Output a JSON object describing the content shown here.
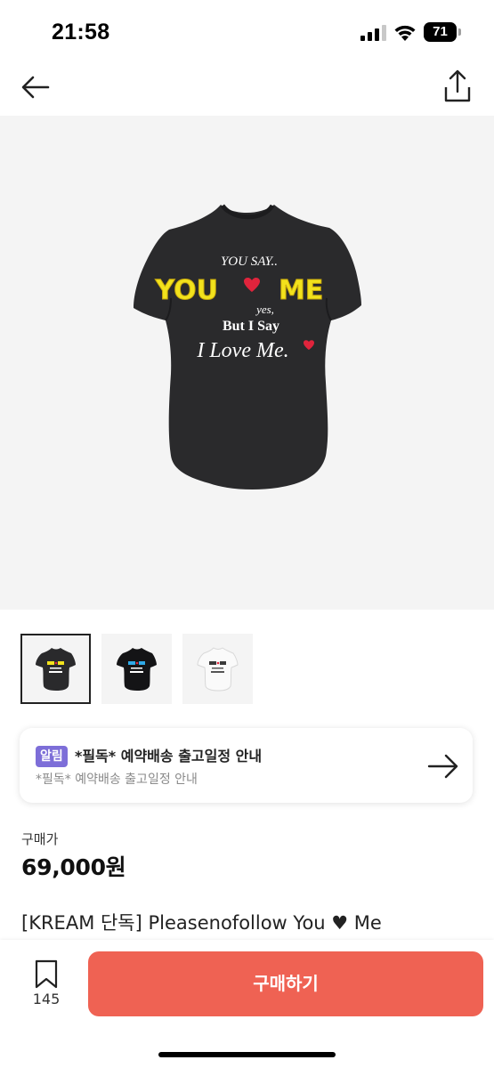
{
  "status_bar": {
    "time": "21:58",
    "battery": "71"
  },
  "shirt_print": {
    "line1": "YOU SAY..",
    "line2_you": "YOU",
    "line2_me": "ME",
    "line3": "yes,",
    "line4": "But I Say",
    "line5": "I Love Me."
  },
  "thumbnails": [
    {
      "variant": "black-yellow",
      "selected": true
    },
    {
      "variant": "black-blue",
      "selected": false
    },
    {
      "variant": "white",
      "selected": false
    }
  ],
  "notice": {
    "badge": "알림",
    "title": "*필독* 예약배송 출고일정 안내",
    "subtitle": "*필독* 예약배송 출고일정 안내"
  },
  "price": {
    "label": "구매가",
    "value": "69,000원"
  },
  "product_name": "[KREAM 단독] Pleasenofollow You ♥ Me",
  "bottom_bar": {
    "wish_count": "145",
    "buy_label": "구매하기"
  },
  "colors": {
    "buy_button": "#ef6253",
    "badge": "#7d6ed8",
    "shirt": "#2a2a2c",
    "print_yellow": "#f2e21c",
    "heart_red": "#e0243c"
  },
  "icons": [
    "back-arrow-icon",
    "share-icon",
    "arrow-right-icon",
    "bookmark-icon",
    "signal-icon",
    "wifi-icon",
    "battery-icon",
    "heart-icon"
  ]
}
